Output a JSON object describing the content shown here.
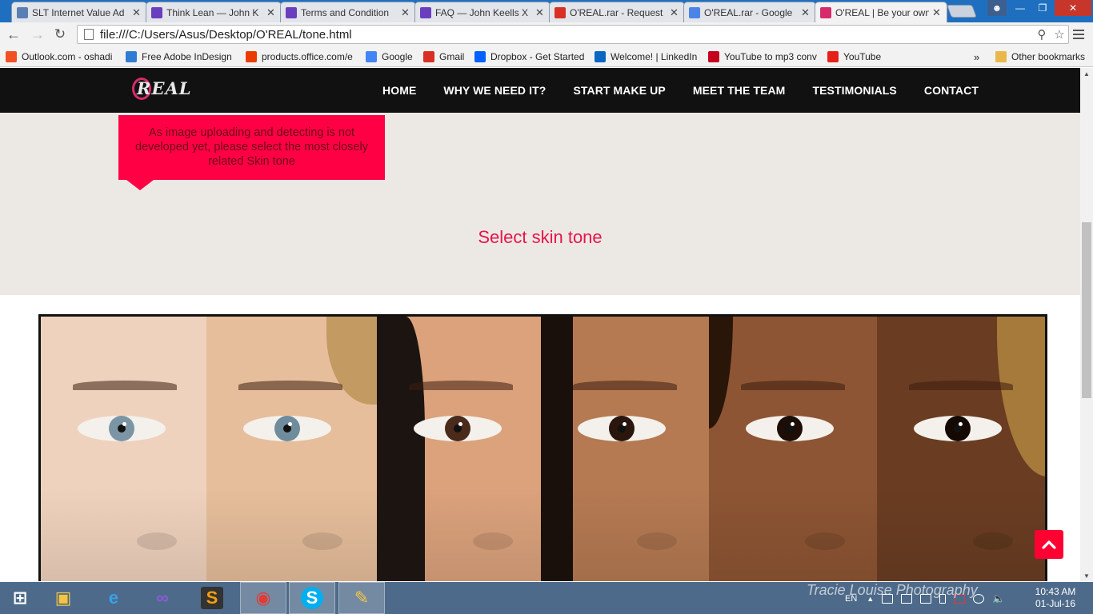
{
  "browser": {
    "tabs": [
      {
        "title": "SLT Internet Value Ad",
        "icon": "slt-icon",
        "color": "#5a7fb5"
      },
      {
        "title": "Think Lean — John K",
        "icon": "jk-icon",
        "color": "#6a3fbf"
      },
      {
        "title": "Terms and Condition",
        "icon": "jk-icon",
        "color": "#6a3fbf"
      },
      {
        "title": "FAQ — John Keells X",
        "icon": "jk-icon",
        "color": "#6a3fbf"
      },
      {
        "title": "O'REAL.rar - Request",
        "icon": "gmail-icon",
        "color": "#d93025"
      },
      {
        "title": "O'REAL.rar - Google",
        "icon": "google-docs-icon",
        "color": "#4a84e8"
      },
      {
        "title": "O'REAL | Be your own",
        "icon": "oreal-icon",
        "color": "#d62b6b"
      }
    ],
    "address_bar": {
      "url": "file:///C:/Users/Asus/Desktop/O'REAL/tone.html"
    },
    "bookmarks": [
      {
        "label": "Outlook.com - oshadi",
        "icon": "windows-icon",
        "color": "#f25022"
      },
      {
        "label": "Free Adobe InDesign",
        "icon": "refresh-icon",
        "color": "#2f7dd3"
      },
      {
        "label": "products.office.com/e",
        "icon": "office-icon",
        "color": "#eb3c00"
      },
      {
        "label": "Google",
        "icon": "google-icon",
        "color": "#4285f4"
      },
      {
        "label": "Gmail",
        "icon": "gmail-icon",
        "color": "#d93025"
      },
      {
        "label": "Dropbox - Get Started",
        "icon": "dropbox-icon",
        "color": "#0061fe"
      },
      {
        "label": "Welcome! | LinkedIn",
        "icon": "linkedin-icon",
        "color": "#0a66c2"
      },
      {
        "label": "YouTube to mp3 conv",
        "icon": "record-icon",
        "color": "#c4001d"
      },
      {
        "label": "YouTube",
        "icon": "youtube-icon",
        "color": "#e62117"
      }
    ],
    "bookmarks_overflow": "»",
    "other_bookmarks": "Other bookmarks"
  },
  "site": {
    "logo_text": "REAL",
    "nav": [
      "HOME",
      "WHY WE NEED IT?",
      "START MAKE UP",
      "MEET THE TEAM",
      "TESTIMONIALS",
      "CONTACT"
    ],
    "notice": "As image uploading and detecting is not developed yet, please select the most closely related Skin tone",
    "section_title": "Select skin tone",
    "skin_tones": [
      {
        "skin": "#efd2bd",
        "iris": "#7c95a4",
        "hair": "#c9a27a"
      },
      {
        "skin": "#e6be9b",
        "iris": "#6f8c9c",
        "hair": "#c29a62"
      },
      {
        "skin": "#dba27c",
        "iris": "#4a2a1a",
        "hair": "#1c1410"
      },
      {
        "skin": "#b57a52",
        "iris": "#2a160c",
        "hair": "#1a100b"
      },
      {
        "skin": "#8d5533",
        "iris": "#1c0d06",
        "hair": "#2a1509"
      },
      {
        "skin": "#6a3d22",
        "iris": "#150903",
        "hair": "#a67a3a"
      }
    ],
    "photo_credit": "Tracie Louise Photography"
  },
  "taskbar": {
    "apps": [
      "start-icon",
      "file-explorer-icon",
      "internet-explorer-icon",
      "visual-studio-icon",
      "sublime-text-icon",
      "chrome-icon",
      "skype-icon",
      "paint-icon"
    ],
    "language": "EN",
    "time": "10:43 AM",
    "date": "01-Jul-16"
  },
  "colors": {
    "accent": "#ff0044",
    "title": "#e8144b",
    "nav_bg": "#111111",
    "section_bg": "#ece9e4"
  }
}
